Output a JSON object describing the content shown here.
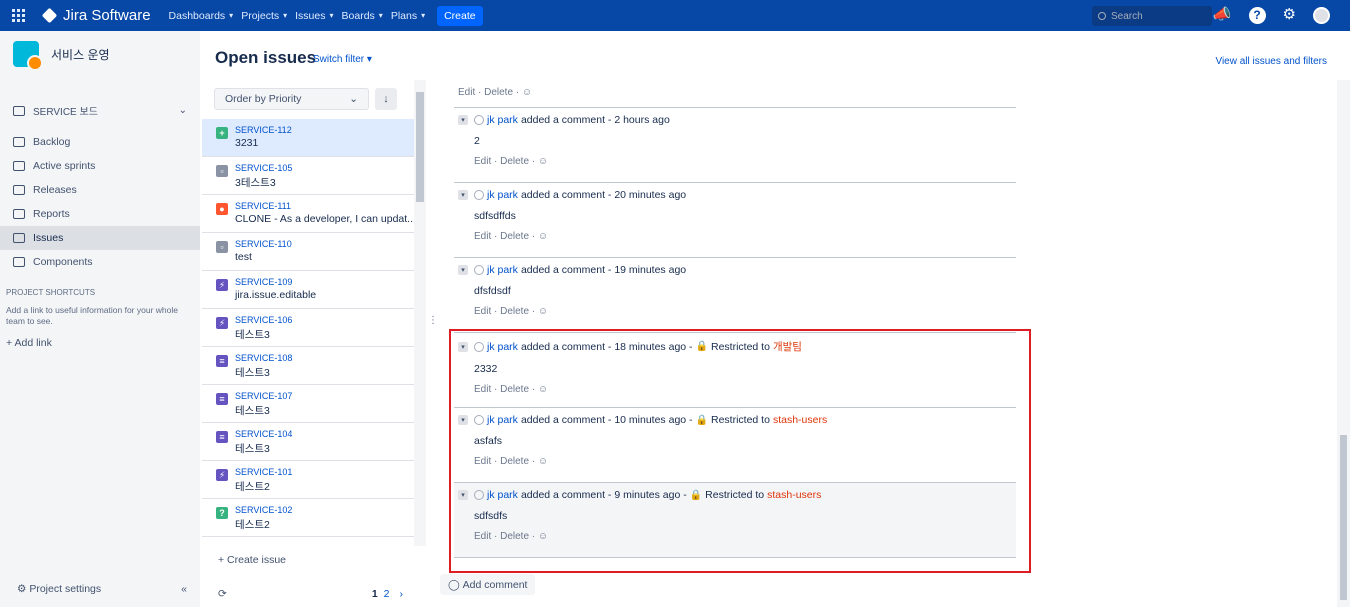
{
  "topbar": {
    "app_name": "Jira Software",
    "nav": [
      "Dashboards",
      "Projects",
      "Issues",
      "Boards",
      "Plans"
    ],
    "create_label": "Create",
    "search_placeholder": "Search"
  },
  "sidebar": {
    "project_name": "서비스 운영",
    "board_label": "SERVICE 보드",
    "items": [
      {
        "label": "Backlog",
        "icon": "backlog-icon"
      },
      {
        "label": "Active sprints",
        "icon": "sprint-icon"
      },
      {
        "label": "Releases",
        "icon": "ship-icon"
      },
      {
        "label": "Reports",
        "icon": "chart-icon"
      },
      {
        "label": "Issues",
        "icon": "issues-icon",
        "active": true
      },
      {
        "label": "Components",
        "icon": "puzzle-icon"
      }
    ],
    "shortcuts_heading": "PROJECT SHORTCUTS",
    "shortcuts_desc": "Add a link to useful information for your whole team to see.",
    "add_link": "+ Add link",
    "settings_label": "Project settings"
  },
  "header": {
    "title": "Open issues",
    "switch_filter": "Switch filter",
    "view_all": "View all issues and filters"
  },
  "issue_list": {
    "order_label": "Order by Priority",
    "issues": [
      {
        "key": "SERVICE-112",
        "summary": "3231",
        "type": "improvement",
        "color": "#36b37e",
        "selected": true
      },
      {
        "key": "SERVICE-105",
        "summary": "3테스트3",
        "type": "task",
        "color": "#8993a4"
      },
      {
        "key": "SERVICE-111",
        "summary": "CLONE - As a developer, I can updat...",
        "type": "bug",
        "color": "#ff5630"
      },
      {
        "key": "SERVICE-110",
        "summary": "test",
        "type": "task",
        "color": "#8993a4"
      },
      {
        "key": "SERVICE-109",
        "summary": "jira.issue.editable",
        "type": "epic",
        "color": "#6554c0"
      },
      {
        "key": "SERVICE-106",
        "summary": "테스트3",
        "type": "epic",
        "color": "#6554c0"
      },
      {
        "key": "SERVICE-108",
        "summary": "테스트3",
        "type": "story",
        "color": "#6554c0"
      },
      {
        "key": "SERVICE-107",
        "summary": "테스트3",
        "type": "story",
        "color": "#6554c0"
      },
      {
        "key": "SERVICE-104",
        "summary": "테스트3",
        "type": "story",
        "color": "#6554c0"
      },
      {
        "key": "SERVICE-101",
        "summary": "테스트2",
        "type": "epic",
        "color": "#6554c0"
      },
      {
        "key": "SERVICE-102",
        "summary": "테스트2",
        "type": "question",
        "color": "#36b37e"
      }
    ],
    "create_issue": "+ Create issue",
    "pages": [
      "1",
      "2"
    ]
  },
  "comments": {
    "actions": "Edit · Delete ·",
    "items": [
      {
        "user": "jk park",
        "meta": "added a comment - 2 hours ago",
        "body": "2",
        "restricted": ""
      },
      {
        "user": "jk park",
        "meta": "added a comment - 20 minutes ago",
        "body": "sdfsdffds",
        "restricted": ""
      },
      {
        "user": "jk park",
        "meta": "added a comment - 19 minutes ago",
        "body": "dfsfdsdf",
        "restricted": ""
      },
      {
        "user": "jk park",
        "meta": "added a comment - 18 minutes ago -",
        "body": "2332",
        "restricted": "개발팀"
      },
      {
        "user": "jk park",
        "meta": "added a comment - 10 minutes ago -",
        "body": "asfafs",
        "restricted": "stash-users"
      },
      {
        "user": "jk park",
        "meta": "added a comment - 9 minutes ago -",
        "body": "sdfsdfs",
        "restricted": "stash-users",
        "highlight": true
      }
    ],
    "restricted_prefix": "Restricted to",
    "add_comment": "Add comment"
  }
}
